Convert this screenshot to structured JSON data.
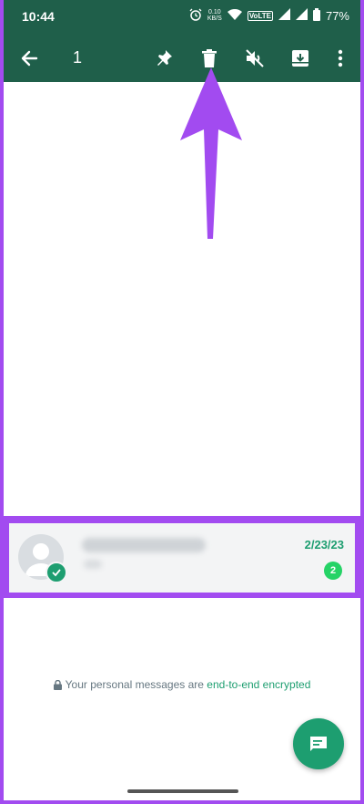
{
  "status_bar": {
    "time": "10:44",
    "net_speed_top": "0.10",
    "net_speed_bottom": "KB/S",
    "network_tag": "VoLTE",
    "battery": "77%"
  },
  "action_bar": {
    "selected_count": "1",
    "icons": [
      "back-arrow-icon",
      "pin-icon",
      "delete-icon",
      "mute-icon",
      "archive-icon",
      "more-vert-icon"
    ]
  },
  "chat": {
    "date": "2/23/23",
    "unread_count": "2"
  },
  "encryption": {
    "prefix": "Your personal messages are",
    "link": "end-to-end encrypted"
  },
  "colors": {
    "header": "#1f5f4a",
    "accent": "#1d9e70",
    "unread_badge": "#25d366",
    "highlight_border": "#a24bf0"
  }
}
